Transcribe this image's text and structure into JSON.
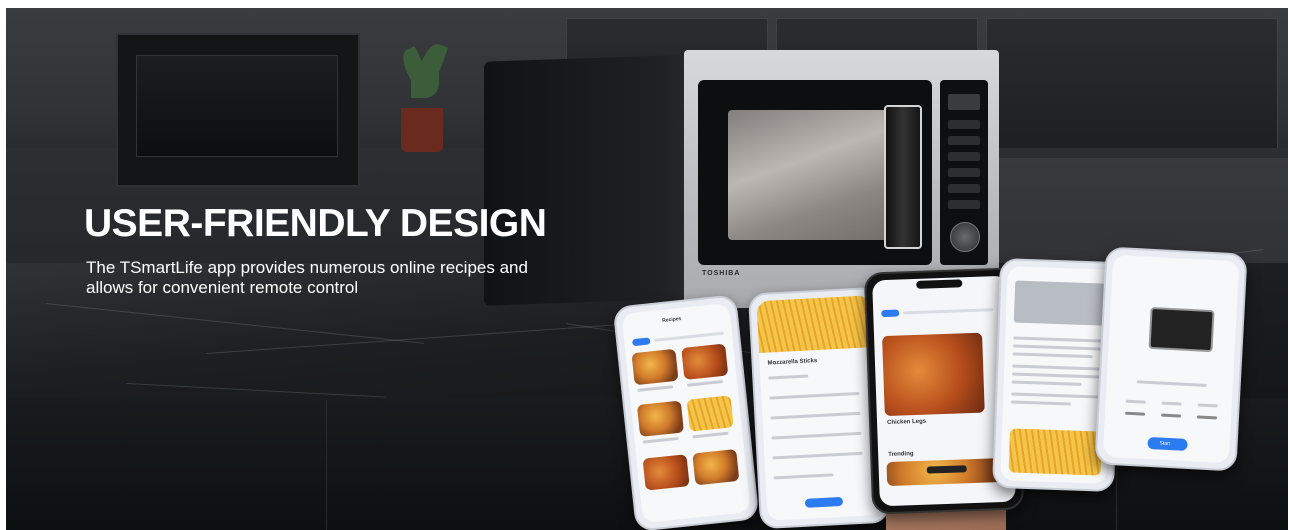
{
  "headline": "USER-FRIENDLY DESIGN",
  "subline": "The TSmartLife app provides numerous online recipes and allows for convenient remote control",
  "microwave_brand": "TOSHIBA",
  "phones": {
    "phone1_title": "Recipes",
    "phone2_title": "Mozzarella Sticks",
    "phone3_dish": "Chicken Legs",
    "phone3_section": "Trending",
    "phone5_action": "Start"
  },
  "colors": {
    "headline": "#ffffff",
    "accent": "#2d7bf0"
  }
}
